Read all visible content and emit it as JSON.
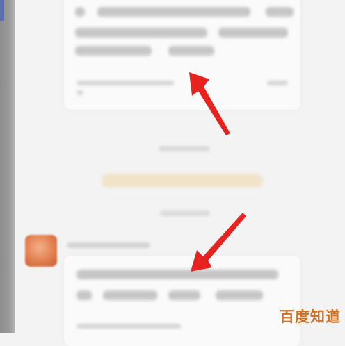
{
  "watermark": {
    "text": "百度知道"
  },
  "colors": {
    "arrow": "#e8231f",
    "watermark": "#d46f20",
    "banner": "#f0e2c6"
  },
  "icons": [
    "red-arrow-icon"
  ]
}
